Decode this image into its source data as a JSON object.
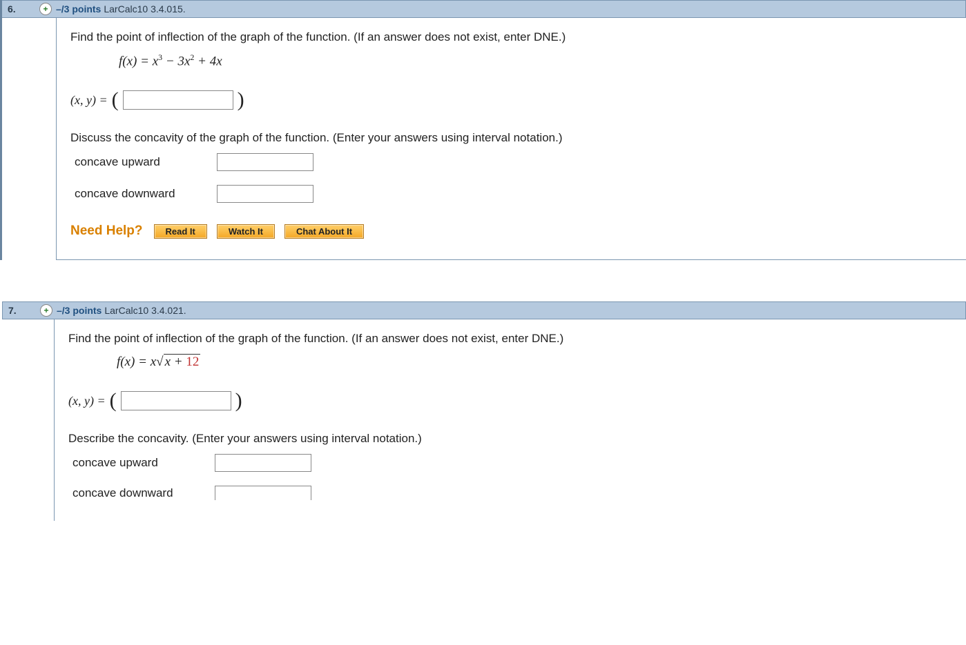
{
  "q6": {
    "number": "6.",
    "points": "–/3 points",
    "ref": "LarCalc10 3.4.015.",
    "instr": "Find the point of inflection of the graph of the function. (If an answer does not exist, enter DNE.)",
    "formula_prefix": "f(x) = x",
    "formula_mid": " − 3x",
    "formula_suffix": " + 4x",
    "answer_label": "(x, y) = ",
    "discuss": "Discuss the concavity of the graph of the function. (Enter your answers using interval notation.)",
    "up": "concave upward",
    "down": "concave downward",
    "help_label": "Need Help?",
    "read": "Read It",
    "watch": "Watch It",
    "chat": "Chat About It"
  },
  "q7": {
    "number": "7.",
    "points": "–/3 points",
    "ref": "LarCalc10 3.4.021.",
    "instr": "Find the point of inflection of the graph of the function. (If an answer does not exist, enter DNE.)",
    "formula_fx": "f(x) = x",
    "sqrt_inner_x": "x + ",
    "sqrt_const": "12",
    "answer_label": "(x, y) = ",
    "discuss": "Describe the concavity. (Enter your answers using interval notation.)",
    "up": "concave upward",
    "down": "concave downward"
  }
}
